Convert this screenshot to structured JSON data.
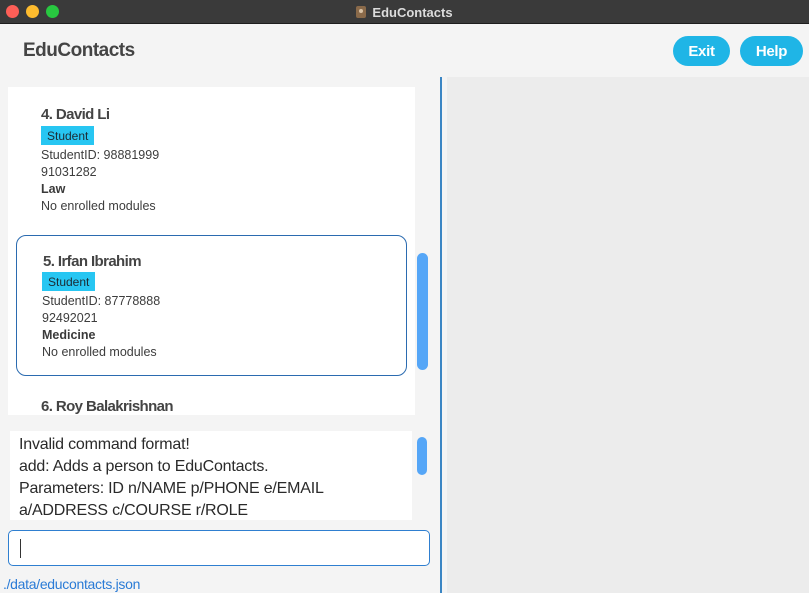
{
  "window": {
    "title": "EduContacts"
  },
  "header": {
    "brand": "EduContacts",
    "exit_label": "Exit",
    "help_label": "Help"
  },
  "contacts": [
    {
      "name": "4. David Li",
      "role": "Student",
      "student_id": "StudentID: 98881999",
      "phone": "91031282",
      "course": "Law",
      "modules": "No enrolled modules"
    },
    {
      "name": "5. Irfan Ibrahim",
      "role": "Student",
      "student_id": "StudentID: 87778888",
      "phone": "92492021",
      "course": "Medicine",
      "modules": "No enrolled modules",
      "selected": true
    },
    {
      "name": "6. Roy Balakrishnan"
    }
  ],
  "result": {
    "lines": [
      "Invalid command format!",
      "add: Adds a person to EduContacts.",
      "Parameters: ID n/NAME p/PHONE e/EMAIL",
      "a/ADDRESS c/COURSE r/ROLE"
    ]
  },
  "command": {
    "value": ""
  },
  "status": {
    "path": "./data/educontacts.json"
  },
  "colors": {
    "accent": "#1fb5e6",
    "badge": "#27c6f2",
    "border": "#2b6bb0",
    "scrollbar": "#55a6f7",
    "status_text": "#2a7bd6"
  }
}
